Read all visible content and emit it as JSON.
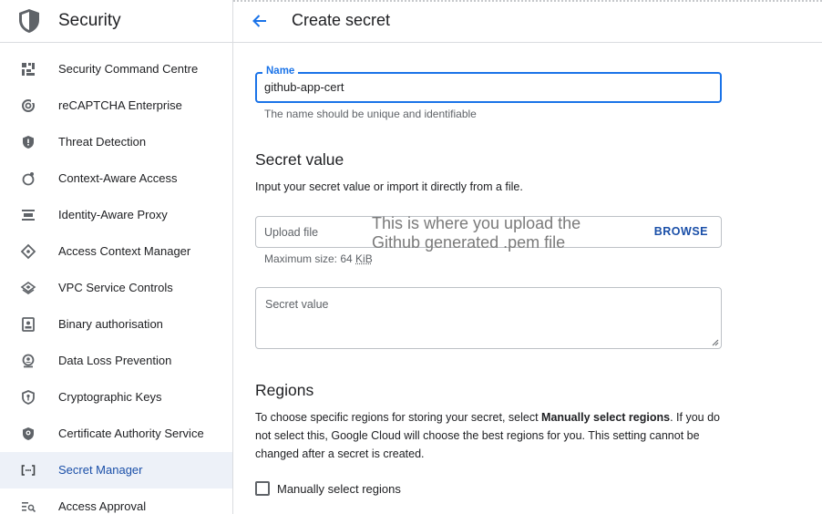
{
  "sidebar": {
    "title": "Security",
    "items": [
      {
        "label": "Security Command Centre",
        "icon": "dashboard-icon"
      },
      {
        "label": "reCAPTCHA Enterprise",
        "icon": "recaptcha-icon"
      },
      {
        "label": "Threat Detection",
        "icon": "shield-alert-icon"
      },
      {
        "label": "Context-Aware Access",
        "icon": "context-aware-icon"
      },
      {
        "label": "Identity-Aware Proxy",
        "icon": "proxy-icon"
      },
      {
        "label": "Access Context Manager",
        "icon": "diamond-icon"
      },
      {
        "label": "VPC Service Controls",
        "icon": "layers-icon"
      },
      {
        "label": "Binary authorisation",
        "icon": "badge-icon"
      },
      {
        "label": "Data Loss Prevention",
        "icon": "search-person-icon"
      },
      {
        "label": "Cryptographic Keys",
        "icon": "key-shield-icon"
      },
      {
        "label": "Certificate Authority Service",
        "icon": "cert-shield-icon"
      },
      {
        "label": "Secret Manager",
        "icon": "brackets-icon",
        "active": true
      },
      {
        "label": "Access Approval",
        "icon": "list-search-icon"
      }
    ]
  },
  "header": {
    "title": "Create secret"
  },
  "form": {
    "name_label": "Name",
    "name_value": "github-app-cert",
    "name_hint": "The name should be unique and identifiable",
    "secret_value_title": "Secret value",
    "secret_value_desc": "Input your secret value or import it directly from a file.",
    "upload_label": "Upload file",
    "browse_label": "BROWSE",
    "annotation_line1": "This is where you upload the",
    "annotation_line2": "Github generated .pem file",
    "max_size_prefix": "Maximum size: 64 ",
    "max_size_unit": "KiB",
    "secret_placeholder": "Secret value",
    "regions_title": "Regions",
    "regions_desc_1": "To choose specific regions for storing your secret, select ",
    "regions_desc_bold": "Manually select regions",
    "regions_desc_2": ". If you do not select this, Google Cloud will choose the best regions for you. This setting cannot be changed after a secret is created.",
    "manual_regions_label": "Manually select regions"
  },
  "colors": {
    "accent": "#1a73e8",
    "active_bg": "#edf1f8",
    "active_text": "#1a4fa8"
  }
}
